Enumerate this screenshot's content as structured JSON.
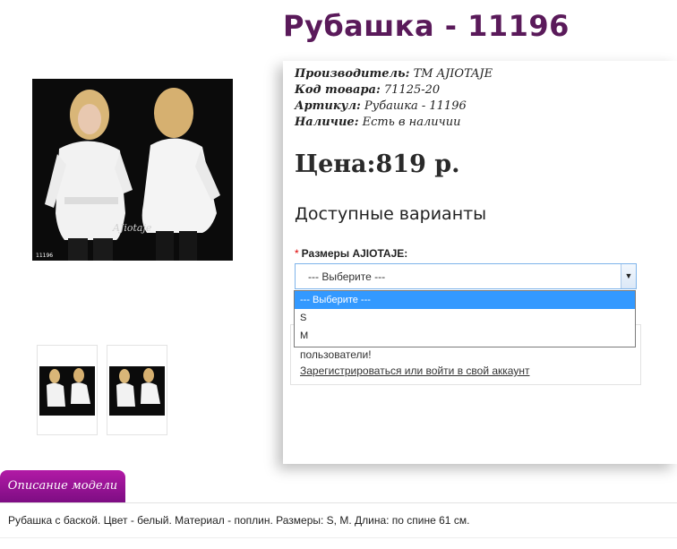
{
  "product": {
    "title": "Рубашка - 11196",
    "manufacturer_label": "Производитель:",
    "manufacturer_value": "ТМ AJIOTAJE",
    "code_label": "Код товара:",
    "code_value": "71125-20",
    "sku_label": "Артикул:",
    "sku_value": "Рубашка - 11196",
    "stock_label": "Наличие:",
    "stock_value": "Есть в наличии",
    "price": "Цена:819 р.",
    "image_caption": "11196",
    "image_watermark": "AJiotaje"
  },
  "variants": {
    "title": "Доступные варианты",
    "required_mark": "*",
    "size_label": "Размеры AJIOTAJE:",
    "selected": "--- Выберите ---",
    "options": [
      "--- Выберите ---",
      "S",
      "M"
    ]
  },
  "notice": {
    "text": "пользователи!",
    "link": "Зарегистрироваться или войти в свой аккаунт"
  },
  "tabs": {
    "description_label": "Описание модели"
  },
  "description": {
    "text": "Рубашка с баской. Цвет - белый. Материал - поплин. Размеры: S, M. Длина: по спине 61 см."
  },
  "colors": {
    "title": "#5a1a5a",
    "tab_gradient_top": "#b21aa6",
    "tab_gradient_bottom": "#7d0d83",
    "select_highlight": "#3399ff"
  }
}
